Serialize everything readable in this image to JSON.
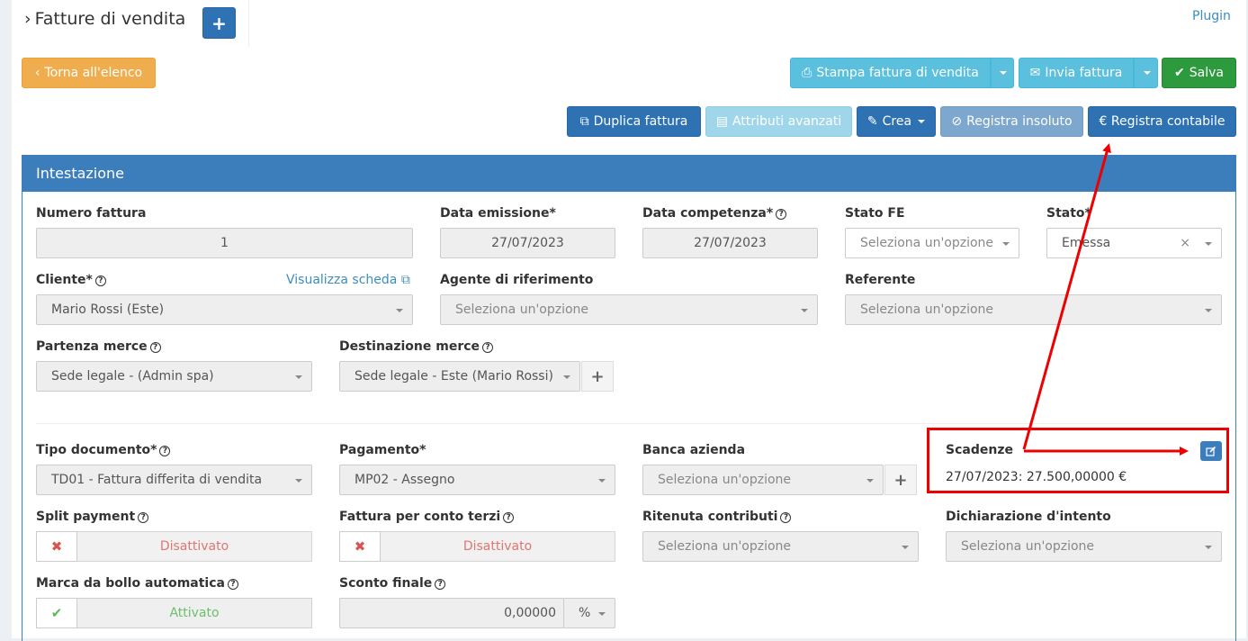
{
  "header": {
    "title": "Fatture di vendita",
    "plugin_link": "Plugin"
  },
  "toolbar": {
    "back_label": "Torna all'elenco",
    "print_label": "Stampa fattura di vendita",
    "send_label": "Invia fattura",
    "save_label": "Salva",
    "duplicate_label": "Duplica fattura",
    "attributes_label": "Attributi avanzati",
    "create_label": "Crea",
    "unpaid_label": "Registra insoluto",
    "accounting_label": "€ Registra contabile"
  },
  "panel": {
    "title": "Intestazione"
  },
  "form": {
    "numero_fattura": {
      "label": "Numero fattura",
      "value": "1"
    },
    "data_emissione": {
      "label": "Data emissione*",
      "value": "27/07/2023"
    },
    "data_competenza": {
      "label": "Data competenza*",
      "value": "27/07/2023"
    },
    "stato_fe": {
      "label": "Stato FE",
      "placeholder": "Seleziona un'opzione"
    },
    "stato": {
      "label": "Stato*",
      "value": "Emessa"
    },
    "cliente": {
      "label": "Cliente*",
      "value": "Mario Rossi (Este)",
      "link": "Visualizza scheda"
    },
    "agente": {
      "label": "Agente di riferimento",
      "placeholder": "Seleziona un'opzione"
    },
    "referente": {
      "label": "Referente",
      "placeholder": "Seleziona un'opzione"
    },
    "partenza": {
      "label": "Partenza merce",
      "value": "Sede legale - (Admin spa)"
    },
    "destinazione": {
      "label": "Destinazione merce",
      "value": "Sede legale - Este (Mario Rossi)"
    },
    "tipo_documento": {
      "label": "Tipo documento*",
      "value": "TD01 - Fattura differita di vendita"
    },
    "pagamento": {
      "label": "Pagamento*",
      "value": "MP02 - Assegno"
    },
    "banca": {
      "label": "Banca azienda",
      "placeholder": "Seleziona un'opzione"
    },
    "scadenze": {
      "label": "Scadenze",
      "value": "27/07/2023: 27.500,00000 €"
    },
    "split_payment": {
      "label": "Split payment",
      "value": "Disattivato"
    },
    "conto_terzi": {
      "label": "Fattura per conto terzi",
      "value": "Disattivato"
    },
    "ritenuta": {
      "label": "Ritenuta contributi",
      "placeholder": "Seleziona un'opzione"
    },
    "dichiarazione": {
      "label": "Dichiarazione d'intento",
      "placeholder": "Seleziona un'opzione"
    },
    "marca_bollo": {
      "label": "Marca da bollo automatica",
      "value": "Attivato"
    },
    "sconto_finale": {
      "label": "Sconto finale",
      "value": "0,00000",
      "unit": "%"
    }
  },
  "colors": {
    "primary": "#3c8dbc",
    "header": "#3c7dbc",
    "annotation": "#e00000"
  }
}
